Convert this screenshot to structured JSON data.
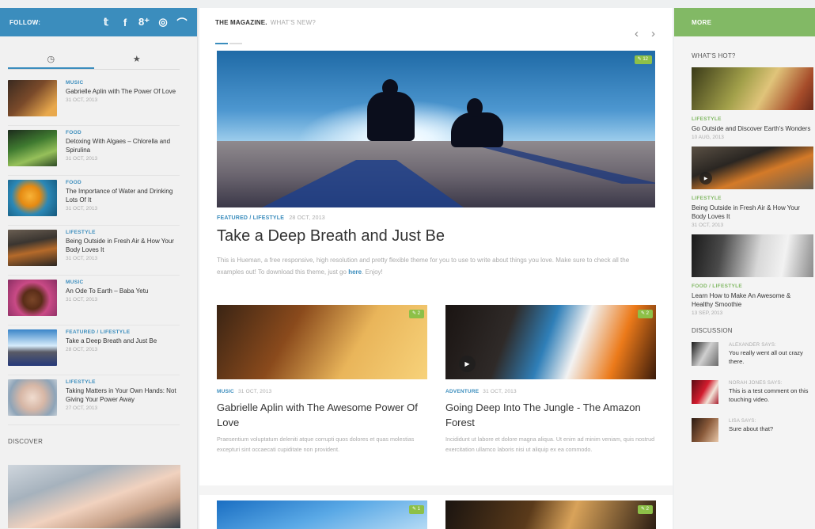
{
  "left_sidebar": {
    "follow_label": "FOLLOW:",
    "social_icons": [
      {
        "name": "twitter-icon",
        "glyph": "𝕥"
      },
      {
        "name": "facebook-icon",
        "glyph": "f"
      },
      {
        "name": "google-plus-icon",
        "glyph": "8⁺"
      },
      {
        "name": "dribbble-icon",
        "glyph": "◎"
      },
      {
        "name": "rss-icon",
        "glyph": "⌒"
      }
    ],
    "tabs": [
      {
        "name": "tab-recent",
        "glyph": "◷"
      },
      {
        "name": "tab-popular",
        "glyph": "★"
      }
    ],
    "posts": [
      {
        "category": "MUSIC",
        "title": "Gabrielle Aplin with The Power Of Love",
        "date": "31 OCT, 2013",
        "thumb": "linear-gradient(135deg,#3a2a20 0%,#7a4a2a 45%,#e8a84c 85%)"
      },
      {
        "category": "FOOD",
        "title": "Detoxing With Algaes – Chlorella and Spirulina",
        "date": "31 OCT, 2013",
        "thumb": "linear-gradient(160deg,#1c2b1c 0%,#3f7a30 40%,#96c05a 70%,#2d4a25 100%)"
      },
      {
        "category": "FOOD",
        "title": "The Importance of Water and Drinking Lots Of It",
        "date": "31 OCT, 2013",
        "thumb": "radial-gradient(circle at 45% 45%,#f8b338 0%,#e58a12 30%,#2b88b6 55%,#15587c 100%)"
      },
      {
        "category": "LIFESTYLE",
        "title": "Being Outside in Fresh Air & How Your Body Loves It",
        "date": "31 OCT, 2013",
        "thumb": "linear-gradient(170deg,#6a5e52 0%,#3a3530 35%,#b56a2a 60%,#2a2622 100%)"
      },
      {
        "category": "MUSIC",
        "title": "An Ode To Earth – Baba Yetu",
        "date": "31 OCT, 2013",
        "thumb": "radial-gradient(circle at 50% 55%,#7a4628 0%,#5a2d18 30%,#c94a86 55%,#8a2e63 100%)"
      },
      {
        "category": "FEATURED / LIFESTYLE",
        "title": "Take a Deep Breath and Just Be",
        "date": "28 OCT, 2013",
        "thumb": "linear-gradient(180deg,#3a84c8 0%,#d7ecfb 45%,#5a5b66 62%,#263a7a 100%)"
      },
      {
        "category": "LIFESTYLE",
        "title": "Taking Matters in Your Own Hands: Not Giving Your Power Away",
        "date": "27 OCT, 2013",
        "thumb": "radial-gradient(circle at 50% 50%,#f0dccf 0%,#d7b7a6 40%,#8ea4b8 75%,#c2ccd5 100%)"
      }
    ],
    "discover_label": "DISCOVER"
  },
  "main": {
    "header_title": "THE MAGAZINE.",
    "header_sub": "WHAT'S NEW?",
    "prev_glyph": "‹",
    "next_glyph": "›",
    "featured": {
      "comments": "12",
      "category": "FEATURED / LIFESTYLE",
      "date": "28 OCT, 2013",
      "title": "Take a Deep Breath and Just Be",
      "excerpt": "This is Hueman, a free responsive, high resolution and pretty flexible theme for you to use to write about things you love. Make sure to check all the examples out! To download this theme, just go",
      "link_text": "here",
      "excerpt_end": ". Enjoy!"
    },
    "posts": [
      {
        "comments": "2",
        "category": "MUSIC",
        "date": "31 OCT, 2013",
        "title": "Gabrielle Aplin with The Awesome Power Of Love",
        "excerpt": "Praesentium voluptatum deleniti atque corrupti quos dolores et quas molestias excepturi sint occaecati cupiditate non provident.",
        "image": "linear-gradient(120deg,#3a2414 0%,#8a4a1c 35%,#e9b55a 65%,#f7d27a 100%)"
      },
      {
        "comments": "2",
        "category": "ADVENTURE",
        "date": "31 OCT, 2013",
        "title": "Going Deep Into The Jungle - The Amazon Forest",
        "excerpt": "Incididunt ut labore et dolore magna aliqua. Ut enim ad minim veniam, quis nostrud exercitation ullamco laboris nisi ut aliquip ex ea commodo.",
        "image": "linear-gradient(110deg,#1a1412 0%,#2f2a28 30%,#2f7fb8 48%,#f2f2f2 62%,#ec7a1a 80%,#3a1a0a 100%)"
      }
    ],
    "bottom_comments": [
      "1",
      "2"
    ]
  },
  "right_sidebar": {
    "more_label": "MORE",
    "whats_hot_label": "WHAT'S HOT?",
    "hot_posts": [
      {
        "category": "LIFESTYLE",
        "title": "Go Outside and Discover Earth's Wonders",
        "date": "10 AUG, 2013",
        "image": "linear-gradient(120deg,#3a3a18 0%,#a2a04a 40%,#e0c47a 60%,#a64c2a 85%,#6a2a1a 100%)"
      },
      {
        "category": "LIFESTYLE",
        "title": "Being Outside in Fresh Air & How Your Body Loves It",
        "date": "31 OCT, 2013",
        "image": "linear-gradient(160deg,#5a5044 0%,#2a2622 35%,#d47a28 60%,#6a5f50 100%)"
      },
      {
        "category": "FOOD / LIFESTYLE",
        "title": "Learn How to Make An Awesome & Healthy Smoothie",
        "date": "13 SEP, 2013",
        "image": "linear-gradient(100deg,#1a1a1a 0%,#4a4a4a 25%,#d8d8d8 55%,#f2f2f2 75%,#8a8a8a 100%)"
      }
    ],
    "discussion_label": "DISCUSSION",
    "comments": [
      {
        "who": "ALEXANDER SAYS:",
        "what": "You really went all out crazy there.",
        "avatar": "linear-gradient(120deg,#1a1a1a 0%,#cfcfcf 50%,#6a6a6a 100%)"
      },
      {
        "who": "NORAH JONES SAYS:",
        "what": "This is a test comment on this touching video.",
        "avatar": "linear-gradient(120deg,#5a0a12 0%,#d21c2e 45%,#f2e4d8 70%,#aa2030 100%)"
      },
      {
        "who": "LISA SAYS:",
        "what": "Sure about that?",
        "avatar": "linear-gradient(120deg,#2a1a12 0%,#8a5a3a 50%,#e8c7a8 100%)"
      }
    ]
  },
  "colors": {
    "accent_blue": "#3b8dbd",
    "accent_green": "#82b965",
    "comment_badge": "#8dc048"
  }
}
